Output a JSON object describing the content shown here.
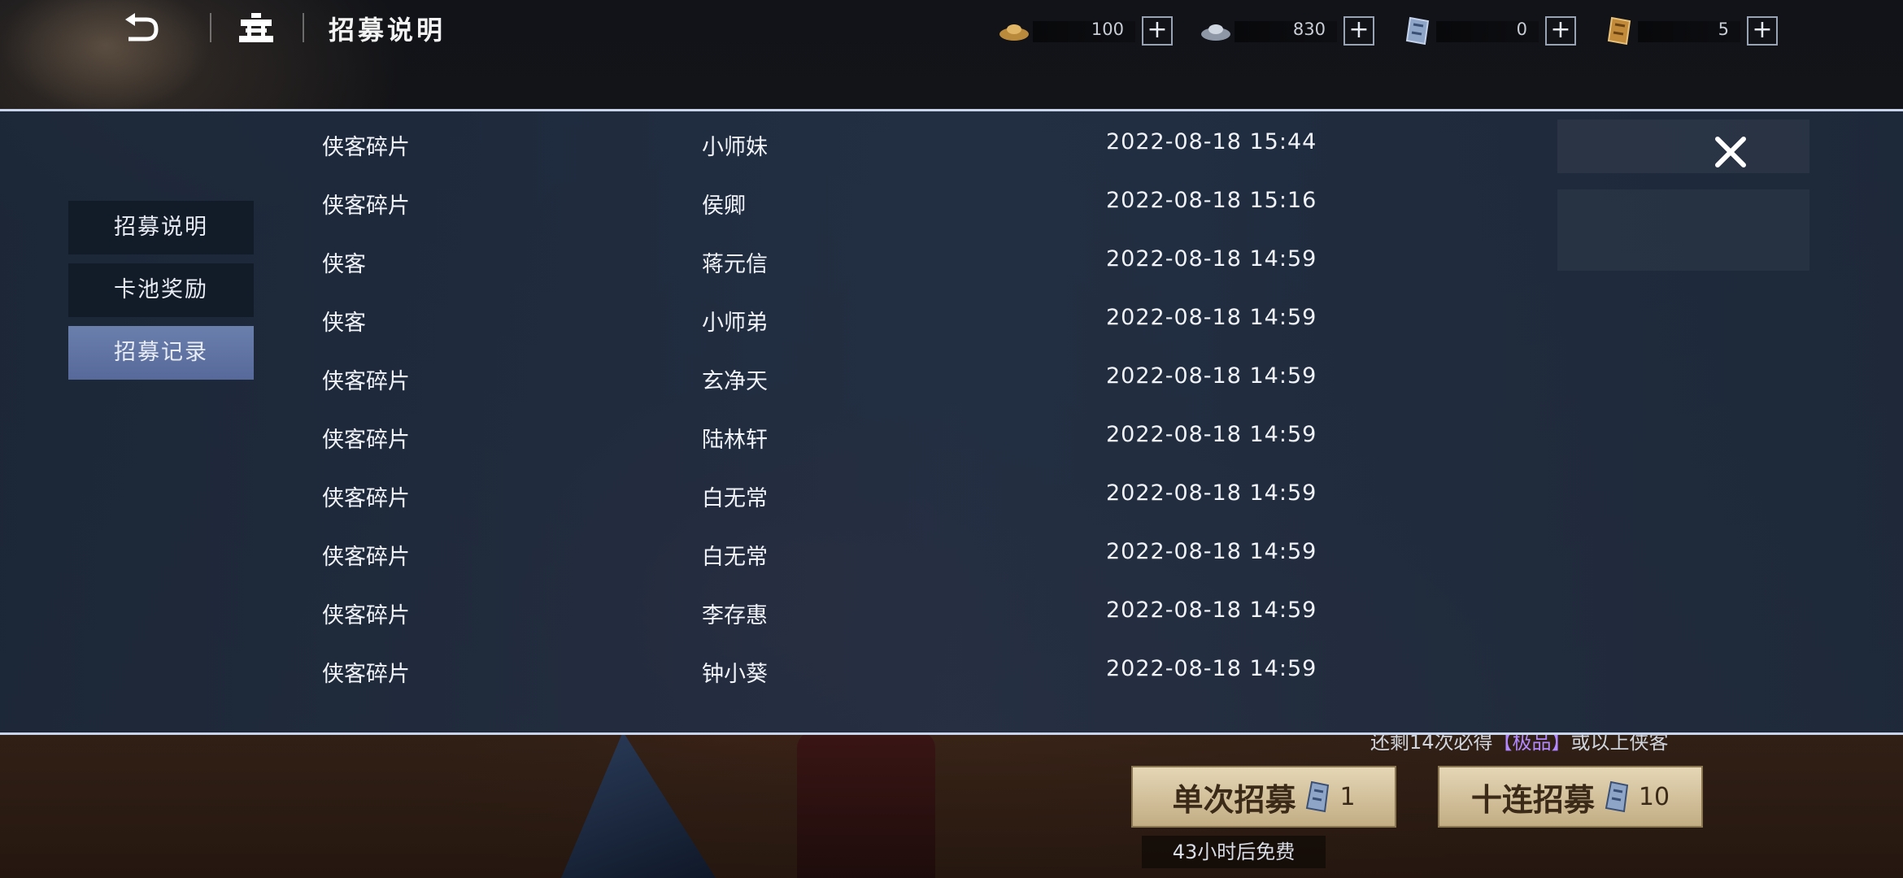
{
  "header": {
    "title": "招募说明",
    "currencies": [
      {
        "icon": "gold-ingot-icon",
        "value": "100"
      },
      {
        "icon": "silver-ingot-icon",
        "value": "830"
      },
      {
        "icon": "blue-recruit-ticket-icon",
        "value": "0"
      },
      {
        "icon": "gold-recruit-ticket-icon",
        "value": "5"
      }
    ]
  },
  "modal": {
    "side_menu": [
      {
        "label": "招募说明",
        "active": false
      },
      {
        "label": "卡池奖励",
        "active": false
      },
      {
        "label": "招募记录",
        "active": true
      }
    ],
    "records": [
      {
        "type": "侠客碎片",
        "name": "小师妹",
        "time": "2022-08-18 15:44"
      },
      {
        "type": "侠客碎片",
        "name": "侯卿",
        "time": "2022-08-18 15:16"
      },
      {
        "type": "侠客",
        "name": "蒋元信",
        "time": "2022-08-18 14:59"
      },
      {
        "type": "侠客",
        "name": "小师弟",
        "time": "2022-08-18 14:59"
      },
      {
        "type": "侠客碎片",
        "name": "玄净天",
        "time": "2022-08-18 14:59"
      },
      {
        "type": "侠客碎片",
        "name": "陆林轩",
        "time": "2022-08-18 14:59"
      },
      {
        "type": "侠客碎片",
        "name": "白无常",
        "time": "2022-08-18 14:59"
      },
      {
        "type": "侠客碎片",
        "name": "白无常",
        "time": "2022-08-18 14:59"
      },
      {
        "type": "侠客碎片",
        "name": "李存惠",
        "time": "2022-08-18 14:59"
      },
      {
        "type": "侠客碎片",
        "name": "钟小葵",
        "time": "2022-08-18 14:59"
      }
    ]
  },
  "bottom": {
    "guarantee_prefix": "还剩14次必得",
    "guarantee_highlight": "【极品】",
    "guarantee_suffix": "或以上侠客",
    "single_label": "单次招募",
    "single_count": "1",
    "ten_label": "十连招募",
    "ten_count": "10",
    "free_note": "43小时后免费"
  },
  "colors": {
    "modal_bg": "#1e2a3c",
    "modal_border": "#c9d4ea",
    "active_menu": "#6276a4",
    "menu_bg": "#121b28",
    "button_gold": "#d9c7a0",
    "highlight_purple": "#b388ff"
  }
}
